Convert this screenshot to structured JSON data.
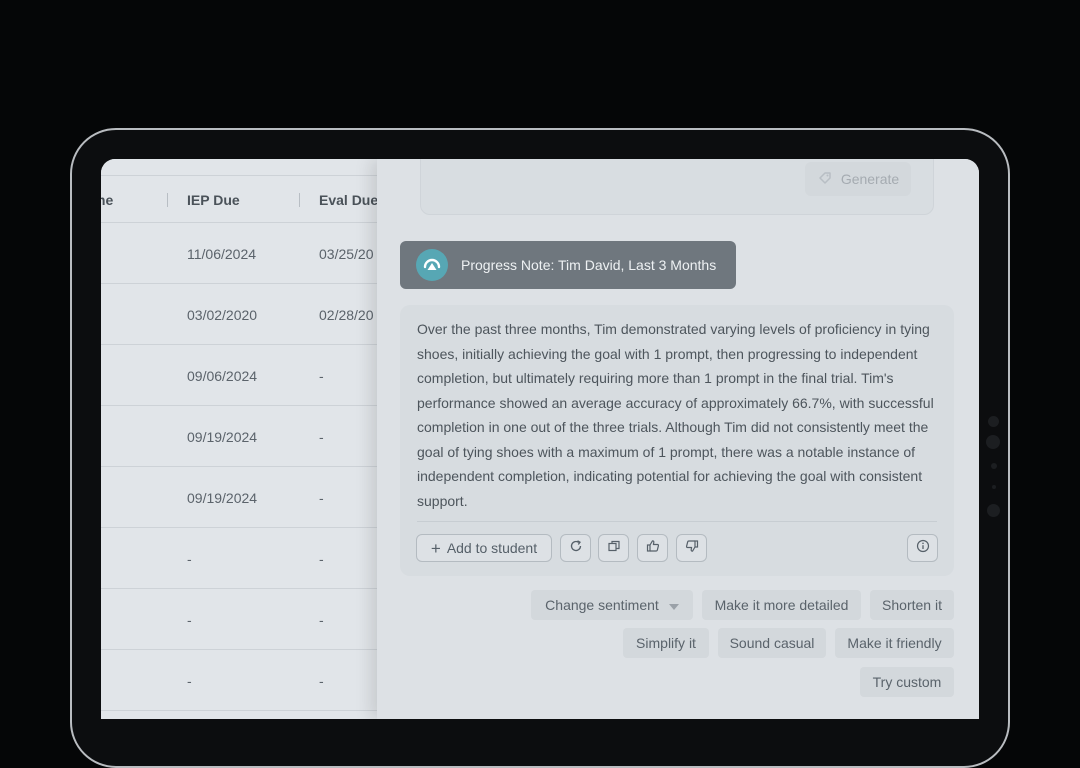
{
  "table": {
    "headers": [
      "me",
      "IEP Due",
      "Eval Due"
    ],
    "rows": [
      [
        "11/06/2024",
        "03/25/20"
      ],
      [
        "03/02/2020",
        "02/28/20"
      ],
      [
        "09/06/2024",
        "-"
      ],
      [
        "09/19/2024",
        "-"
      ],
      [
        "09/19/2024",
        "-"
      ],
      [
        "-",
        "-"
      ],
      [
        "-",
        "-"
      ],
      [
        "-",
        "-"
      ]
    ]
  },
  "generate": {
    "label": "Generate",
    "icon": "sparkle-tag-icon"
  },
  "note": {
    "title": "Progress Note: Tim David, Last 3 Months",
    "logo_icon": "assistant-logo-icon",
    "body": "Over the past three months, Tim demonstrated varying levels of proficiency in tying shoes, initially achieving the goal with 1 prompt, then progressing to independent completion, but ultimately requiring more than 1 prompt in the final trial. Tim's performance showed an average accuracy of approximately 66.7%, with successful completion in one out of the three trials. Although Tim did not consistently meet the goal of tying shoes with a maximum of 1 prompt, there was a notable instance of independent completion, indicating potential for achieving the goal with consistent support."
  },
  "actions": {
    "add_label": "Add to student",
    "icons": [
      "plus-icon",
      "refresh-icon",
      "copy-icon",
      "thumbs-up-icon",
      "thumbs-down-icon",
      "info-icon"
    ]
  },
  "suggestions": {
    "change_sentiment": "Change sentiment",
    "more_detailed": "Make it more detailed",
    "shorten": "Shorten it",
    "simplify": "Simplify it",
    "casual": "Sound casual",
    "friendly": "Make it friendly",
    "custom": "Try custom"
  },
  "colors": {
    "accent": "#57a7b4",
    "note_tag_bg": "#6f777e",
    "screen_bg": "#dfe3e7",
    "page_bg": "#050607"
  }
}
